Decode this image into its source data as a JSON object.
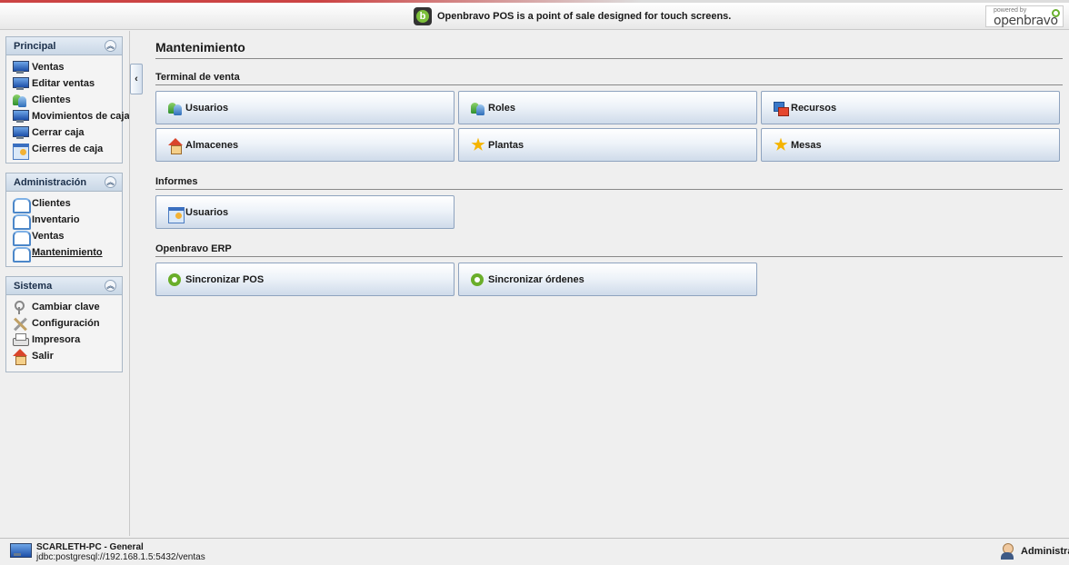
{
  "banner": {
    "message": "Openbravo POS is a point of sale designed for touch screens.",
    "powered_small": "powered by",
    "powered_brand": "openbravo"
  },
  "sidebar": {
    "principal": {
      "title": "Principal",
      "items": [
        {
          "label": "Ventas",
          "icon": "monitor-icon"
        },
        {
          "label": "Editar ventas",
          "icon": "monitor-icon"
        },
        {
          "label": "Clientes",
          "icon": "users-icon"
        },
        {
          "label": "Movimientos de caja",
          "icon": "monitor-icon"
        },
        {
          "label": "Cerrar caja",
          "icon": "monitor-icon"
        },
        {
          "label": "Cierres de caja",
          "icon": "calendar-icon"
        }
      ]
    },
    "administracion": {
      "title": "Administración",
      "items": [
        {
          "label": "Clientes",
          "icon": "book-icon"
        },
        {
          "label": "Inventario",
          "icon": "book-icon"
        },
        {
          "label": "Ventas",
          "icon": "book-icon"
        },
        {
          "label": "Mantenimiento",
          "icon": "book-icon",
          "selected": true
        }
      ]
    },
    "sistema": {
      "title": "Sistema",
      "items": [
        {
          "label": "Cambiar clave",
          "icon": "keys-icon"
        },
        {
          "label": "Configuración",
          "icon": "tools-icon"
        },
        {
          "label": "Impresora",
          "icon": "printer-icon"
        },
        {
          "label": "Salir",
          "icon": "home-icon"
        }
      ]
    }
  },
  "main": {
    "title": "Mantenimiento",
    "sections": [
      {
        "title": "Terminal de venta",
        "rows": [
          [
            {
              "label": "Usuarios",
              "icon": "users-icon"
            },
            {
              "label": "Roles",
              "icon": "users-icon"
            },
            {
              "label": "Recursos",
              "icon": "resources-icon"
            }
          ],
          [
            {
              "label": "Almacenes",
              "icon": "home-icon"
            },
            {
              "label": "Plantas",
              "icon": "star-icon"
            },
            {
              "label": "Mesas",
              "icon": "star-icon"
            }
          ]
        ]
      },
      {
        "title": "Informes",
        "rows": [
          [
            {
              "label": "Usuarios",
              "icon": "calendar-icon"
            }
          ]
        ]
      },
      {
        "title": "Openbravo ERP",
        "rows": [
          [
            {
              "label": "Sincronizar POS",
              "icon": "openbravo-icon"
            },
            {
              "label": "Sincronizar órdenes",
              "icon": "openbravo-icon"
            }
          ]
        ]
      }
    ]
  },
  "status": {
    "host": "SCARLETH-PC - General",
    "db": "jdbc:postgresql://192.168.1.5:5432/ventas",
    "user": "Administrator"
  }
}
